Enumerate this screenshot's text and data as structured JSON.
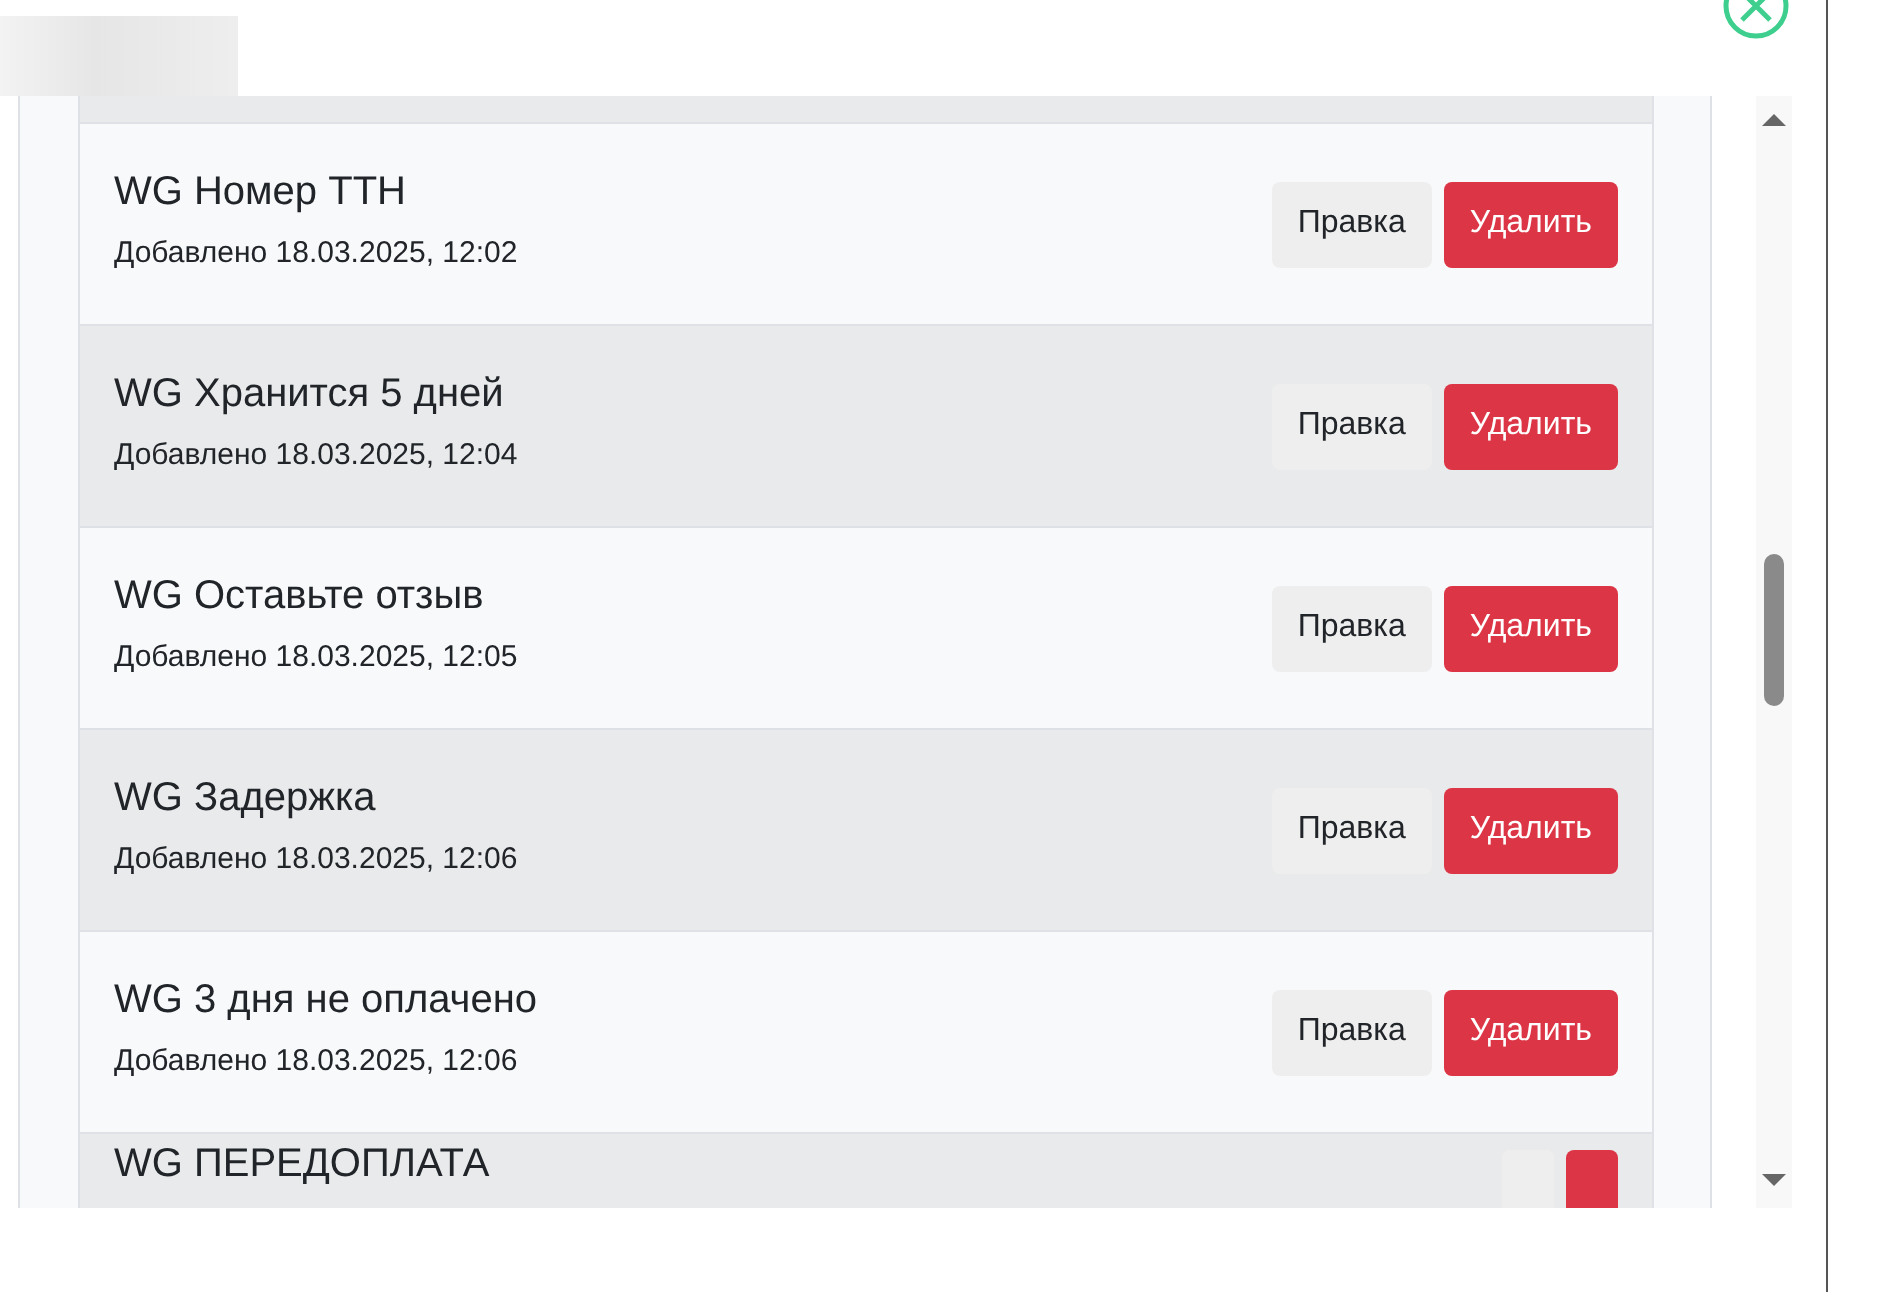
{
  "templates": [
    {
      "title": "WG Номер ТТН",
      "added": "Добавлено 18.03.2025, 12:02",
      "edit": "Правка",
      "delete": "Удалить"
    },
    {
      "title": "WG Хранится 5 дней",
      "added": "Добавлено 18.03.2025, 12:04",
      "edit": "Правка",
      "delete": "Удалить"
    },
    {
      "title": "WG Оставьте отзыв",
      "added": "Добавлено 18.03.2025, 12:05",
      "edit": "Правка",
      "delete": "Удалить"
    },
    {
      "title": "WG Задержка",
      "added": "Добавлено 18.03.2025, 12:06",
      "edit": "Правка",
      "delete": "Удалить"
    },
    {
      "title": "WG 3 дня не оплачено",
      "added": "Добавлено 18.03.2025, 12:06",
      "edit": "Правка",
      "delete": "Удалить"
    },
    {
      "title": "WG ПЕРЕДОПЛАТА"
    }
  ]
}
